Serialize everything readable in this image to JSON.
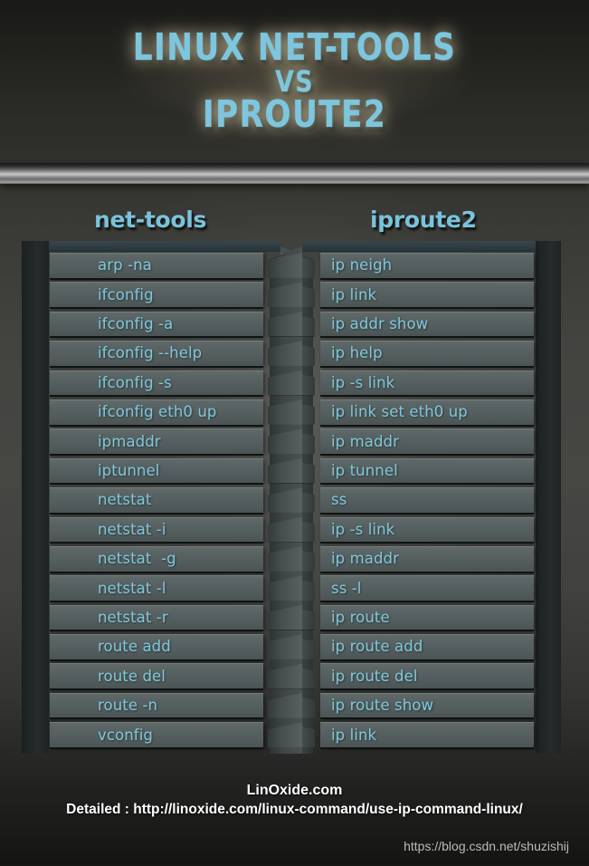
{
  "poster": {
    "title_lines": [
      "LINUX NET-TOOLS",
      "VS",
      "IPROUTE2"
    ],
    "accent_color": "#7dc6de",
    "background_color": "#434340",
    "row_color": "#5a6363"
  },
  "columns": {
    "left": {
      "header": "net-tools",
      "rows": [
        "arp -na",
        "ifconfig",
        "ifconfig -a",
        "ifconfig --help",
        "ifconfig -s",
        "ifconfig eth0 up",
        "ipmaddr",
        "iptunnel",
        "netstat",
        "netstat -i",
        "netstat  -g",
        "netstat -l",
        "netstat -r",
        "route add",
        "route del",
        "route -n",
        "vconfig"
      ]
    },
    "right": {
      "header": "iproute2",
      "rows": [
        "ip neigh",
        "ip link",
        "ip addr show",
        "ip help",
        "ip -s link",
        "ip link set eth0 up",
        "ip maddr",
        "ip tunnel",
        "ss",
        "ip -s link",
        "ip maddr",
        "ss -l",
        "ip route",
        "ip route add",
        "ip route del",
        "ip route show",
        "ip link"
      ]
    }
  },
  "footer": {
    "site": "LinOxide.com",
    "detail": "Detailed : http://linoxide.com/linux-command/use-ip-command-linux/"
  },
  "watermark": "https://blog.csdn.net/shuzishij"
}
